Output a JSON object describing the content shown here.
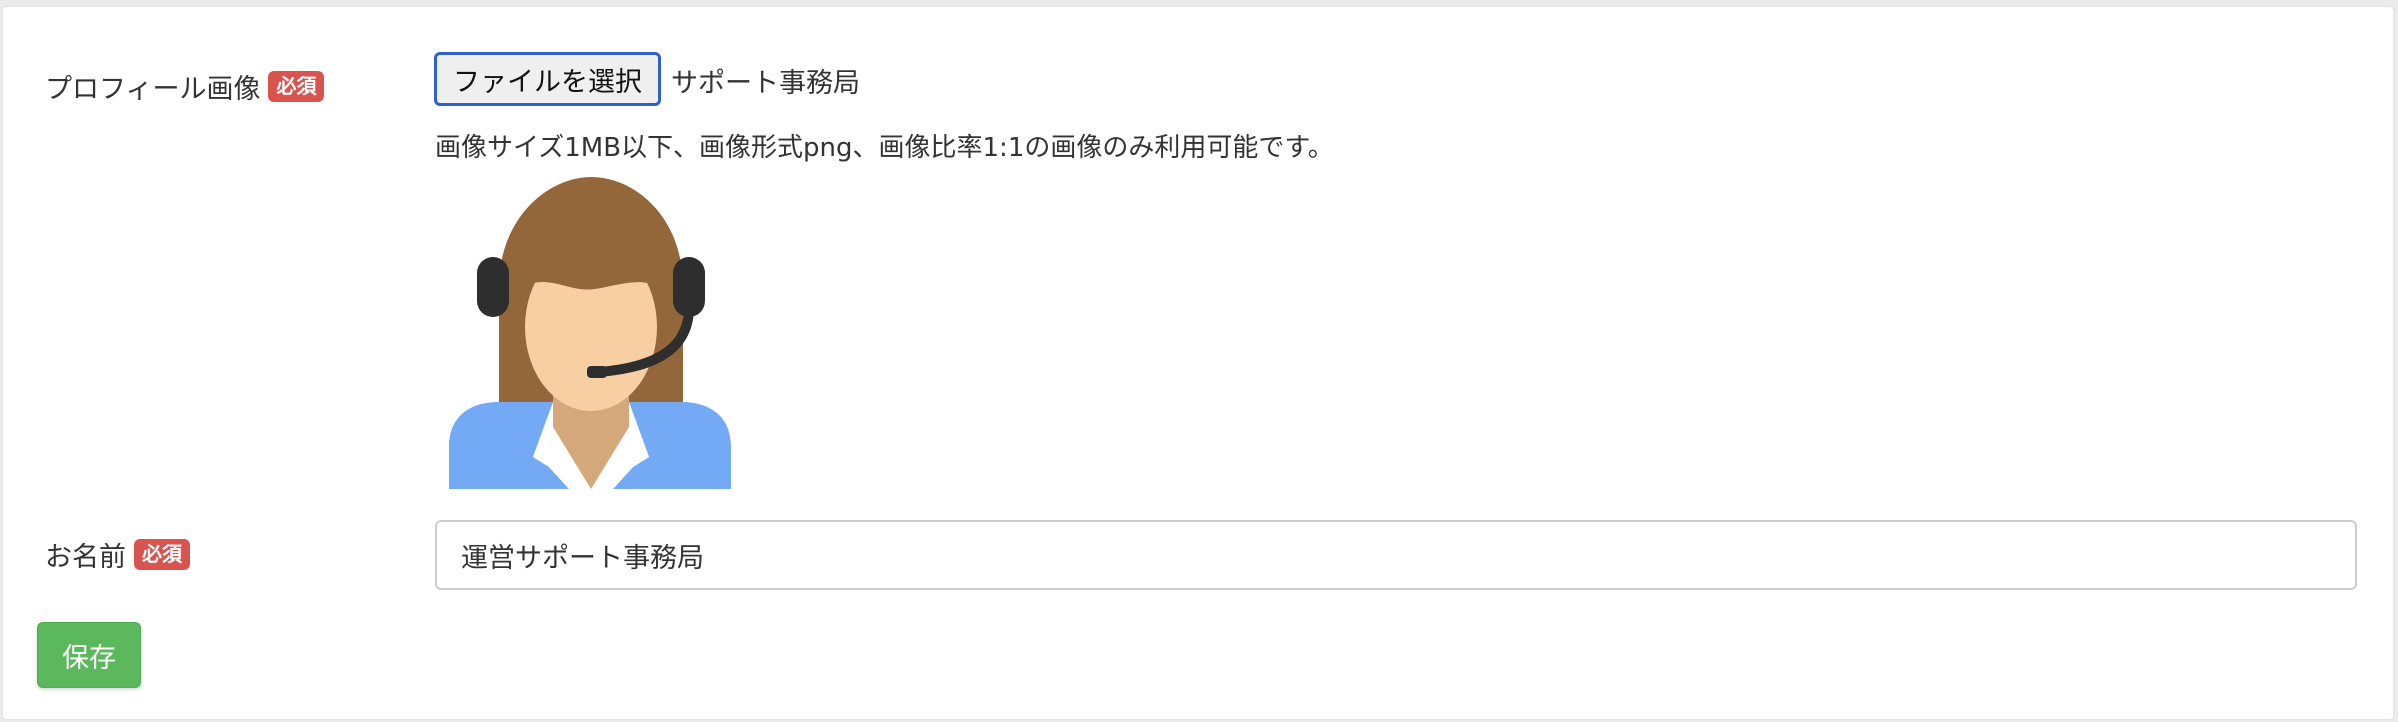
{
  "profile_image": {
    "label": "プロフィール画像",
    "required_badge": "必須",
    "choose_file_label": "ファイルを選択",
    "selected_file_name": "サポート事務局",
    "help_text": "画像サイズ1MB以下、画像形式png、画像比率1:1の画像のみ利用可能です。",
    "preview_icon": "support-operator-icon"
  },
  "name": {
    "label": "お名前",
    "required_badge": "必須",
    "value": "運営サポート事務局"
  },
  "save_button": {
    "label": "保存"
  },
  "colors": {
    "required_badge": "#d9534f",
    "save_button": "#5cb85c",
    "file_button_focus": "#2f62c8"
  }
}
